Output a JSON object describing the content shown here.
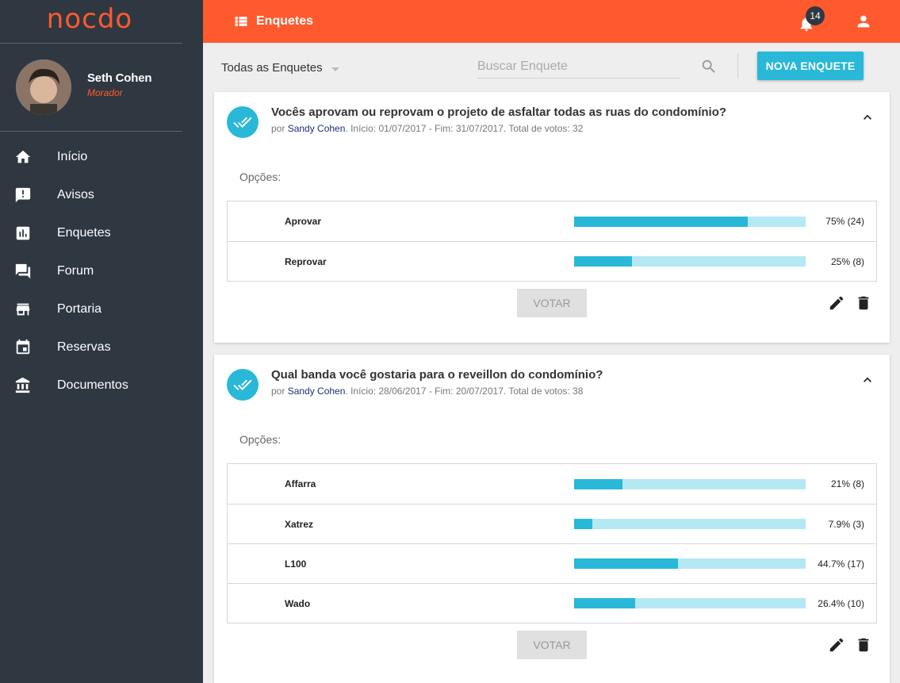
{
  "brand": {
    "logo_text": "nocdo",
    "accent_color": "#ff5a2e",
    "sidebar_color": "#2f3741",
    "primary_color": "#29b8d8"
  },
  "user": {
    "name": "Seth Cohen",
    "role": "Morador"
  },
  "sidebar": {
    "items": [
      {
        "label": "Início",
        "icon": "home-icon"
      },
      {
        "label": "Avisos",
        "icon": "announcement-icon"
      },
      {
        "label": "Enquetes",
        "icon": "poll-icon"
      },
      {
        "label": "Forum",
        "icon": "forum-icon"
      },
      {
        "label": "Portaria",
        "icon": "store-icon"
      },
      {
        "label": "Reservas",
        "icon": "event-icon"
      },
      {
        "label": "Documentos",
        "icon": "bank-icon"
      }
    ]
  },
  "header": {
    "title": "Enquetes",
    "notification_count": "14"
  },
  "filter": {
    "selected": "Todas as Enquetes",
    "search_placeholder": "Buscar Enquete",
    "new_button": "NOVA ENQUETE"
  },
  "polls": [
    {
      "question": "Vocês aprovam ou reprovam o projeto de asfaltar todas as ruas do condomínio?",
      "meta_prefix": "por ",
      "author": "Sandy Cohen",
      "meta_suffix": ". Início: 01/07/2017 - Fim: 31/07/2017. Total de votos: 32",
      "options_label": "Opções:",
      "options": [
        {
          "name": "Aprovar",
          "percent": 75,
          "label": "75% (24)"
        },
        {
          "name": "Reprovar",
          "percent": 25,
          "label": "25% (8)"
        }
      ],
      "vote_label": "VOTAR"
    },
    {
      "question": "Qual banda você gostaria para o reveillon do condomínio?",
      "meta_prefix": "por ",
      "author": "Sandy Cohen",
      "meta_suffix": ". Início: 28/06/2017 - Fim: 20/07/2017. Total de votos: 38",
      "options_label": "Opções:",
      "options": [
        {
          "name": "Affarra",
          "percent": 21,
          "label": "21% (8)"
        },
        {
          "name": "Xatrez",
          "percent": 7.9,
          "label": "7.9% (3)"
        },
        {
          "name": "L100",
          "percent": 44.7,
          "label": "44.7% (17)"
        },
        {
          "name": "Wado",
          "percent": 26.4,
          "label": "26.4% (10)"
        }
      ],
      "vote_label": "VOTAR"
    }
  ]
}
